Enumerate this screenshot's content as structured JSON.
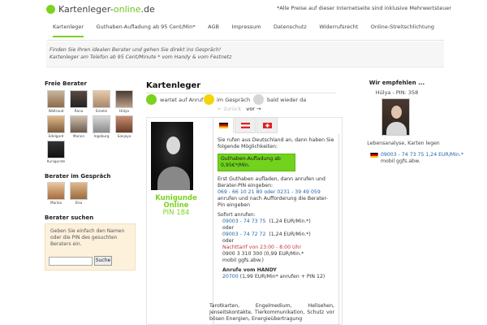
{
  "header": {
    "logo_text_1": "Kartenleger-",
    "logo_text_2": "online",
    "logo_text_3": ".de",
    "note": "*Alle Preise auf dieser Internetseite sind inklusive Mehrwertsteuer"
  },
  "nav": {
    "items": [
      "Kartenleger",
      "Guthaben-Aufladung ab 95 Cent/Min*",
      "AGB",
      "Impressum",
      "Datenschutz",
      "Widerrufsrecht",
      "Online-Streitschlichtung"
    ]
  },
  "infobar": {
    "line1": "Finden Sie Ihren idealen Berater und gehen Sie direkt ins Gespräch!",
    "line2": "Kartenleger am Telefon ab 95 Cent/Minute * vom Handy & vom Festnetz"
  },
  "sidebar": {
    "free_heading": "Freie Berater",
    "free_advisors": [
      "Waltraud",
      "Rana",
      "Emelie",
      "Hülya",
      "Edelgard",
      "Marion",
      "Ingeburg",
      "Sanjaya",
      "Kunigunde"
    ],
    "busy_heading": "Berater im Gespräch",
    "busy_advisors": [
      "Marika",
      "Elsa"
    ],
    "search_heading": "Berater suchen",
    "search_text": "Geben Sie einfach den Namen oder die PIN des gesuchten Beraters ein.",
    "search_button": "Suche",
    "search_value": ""
  },
  "main": {
    "title": "Kartenleger",
    "legend": [
      "wartet auf Anruf",
      "im Gespräch",
      "bald wieder da"
    ],
    "legend_colors": [
      "#7ad320",
      "#f5d40a",
      "#d6d6d6"
    ],
    "pager_prev": "← zurück",
    "pager_next": "vor →"
  },
  "card": {
    "name": "Kunigunde",
    "status": "Online",
    "pin": "PIN 184",
    "intro": "Sie rufen aus Deutschland an, dann haben Sie folgende Möglichkeiten:",
    "topup_button": "Guthaben-Aufladung ab 0,95€*/Min.",
    "step1": "Erst Guthaben aufladen, dann anrufen und Berater-PIN eingeben:",
    "step1_numbers": "069 - 66 10 21 80 oder 0231 - 39 49 059",
    "step1_after": "anrufen und nach Aufforderung die Berater-Pin eingeben",
    "direct_heading": "Sofort anrufen:",
    "direct_line1_number": "09003 - 74 73 75",
    "direct_line1_price": "(1,24 EUR/Min.*)",
    "or1": "oder",
    "direct_line2_number": "09003 - 74 72 72",
    "direct_line2_price": "(1,24 EUR/Min.*)",
    "or2": "oder",
    "night_rate": "Nachttarif von 23:00 - 8:00 Uhr",
    "night_number": "0900 3 310 300 (0,99 EUR/Min.*",
    "night_note": "mobil ggfs.abw.)",
    "mobile_heading": "Anrufe vom HANDY",
    "mobile_number": "20700",
    "mobile_text": "(1,99 EUR/Min* anrufen + PIN 12)",
    "description": "Tarotkarten, Engelmedium, Hellsehen, Jenseitskontakte, Tierkommunikation, Schutz vor bösen Energien, Energieübertragung"
  },
  "recommend": {
    "heading": "Wir empfehlen ...",
    "name_pin": "Hülya - PIN: 358",
    "description": "Lebensanalyse, Karten legen",
    "phone": "09003 - 74 73 75 1,24 EUR/Min.*",
    "phone_note": "mobil ggfs.abw."
  }
}
